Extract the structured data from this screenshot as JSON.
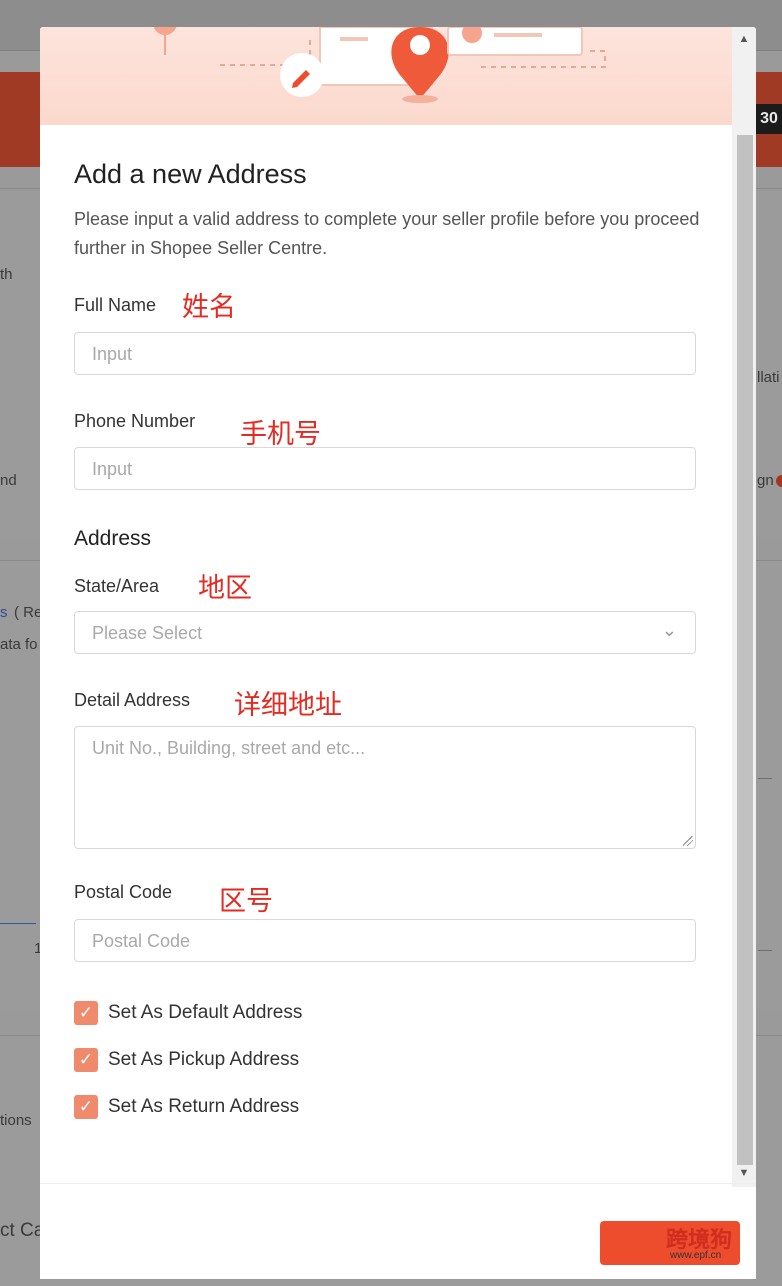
{
  "background": {
    "left_fragments": [
      "th",
      "nd",
      "s",
      "( Re",
      "ata fo",
      "1",
      "tions",
      "ct Ca"
    ],
    "right_fragments": [
      "llati",
      "gn"
    ],
    "timer": "30"
  },
  "modal": {
    "title": "Add a new Address",
    "description": "Please input a valid address to complete your seller profile before you proceed further in Shopee Seller Centre.",
    "full_name": {
      "label": "Full Name",
      "annotation": "姓名",
      "placeholder": "Input"
    },
    "phone": {
      "label": "Phone Number",
      "annotation": "手机号",
      "placeholder": "Input"
    },
    "address_section": "Address",
    "state": {
      "label": "State/Area",
      "annotation": "地区",
      "placeholder": "Please Select"
    },
    "detail": {
      "label": "Detail Address",
      "annotation": "详细地址",
      "placeholder": "Unit No., Building, street and etc..."
    },
    "postal": {
      "label": "Postal Code",
      "annotation": "区号",
      "placeholder": "Postal Code"
    },
    "checkboxes": [
      {
        "label": "Set As Default Address",
        "checked": true
      },
      {
        "label": "Set As Pickup Address",
        "checked": true
      },
      {
        "label": "Set As Return Address",
        "checked": true
      }
    ]
  },
  "watermark": {
    "text": "跨境狗",
    "url": "www.epf.cn"
  },
  "colors": {
    "brand": "#ee4d2d",
    "checkbox": "#ef8a6c",
    "annotation": "#e42b22"
  }
}
